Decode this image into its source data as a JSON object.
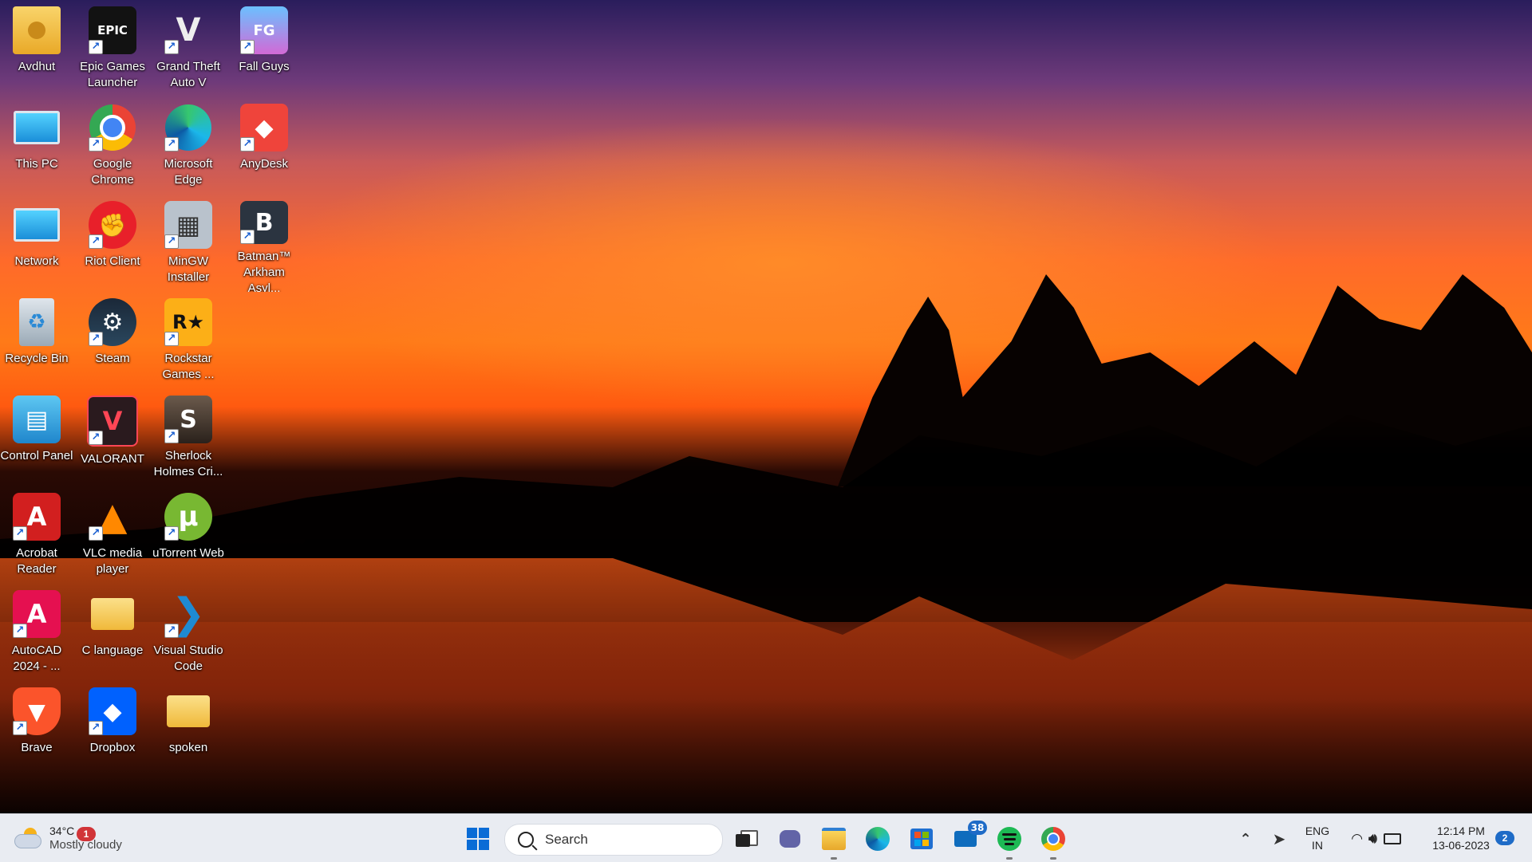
{
  "desktop": {
    "icons": [
      {
        "label": "Avdhut",
        "icon": "folder-user-icon",
        "color": "#f2c14e"
      },
      {
        "label": "Epic Games Launcher",
        "icon": "epic-games-icon",
        "color": "#121212",
        "glyph": "EPIC"
      },
      {
        "label": "Grand Theft Auto V",
        "icon": "gta-v-icon",
        "color": "#1b1b1b",
        "glyph": "V"
      },
      {
        "label": "Fall Guys",
        "icon": "fall-guys-icon",
        "color": "#4aa8ff",
        "glyph": "FG"
      },
      {
        "label": "This PC",
        "icon": "monitor-icon",
        "color": "#3bb3e8"
      },
      {
        "label": "Google Chrome",
        "icon": "chrome-icon",
        "color": "#34a853"
      },
      {
        "label": "Microsoft Edge",
        "icon": "edge-icon",
        "color": "#1f8fd8"
      },
      {
        "label": "AnyDesk",
        "icon": "anydesk-icon",
        "color": "#ef443b",
        "glyph": "◆"
      },
      {
        "label": "Network",
        "icon": "network-globe-icon",
        "color": "#2f8fd6"
      },
      {
        "label": "Riot Client",
        "icon": "riot-fist-icon",
        "color": "#e8202a",
        "glyph": "✊"
      },
      {
        "label": "MinGW Installer",
        "icon": "mingw-installer-icon",
        "color": "#b9c2cc",
        "glyph": "▦"
      },
      {
        "label": "Batman™ Arkham Asyl...",
        "icon": "batman-icon",
        "color": "#2b3440",
        "glyph": "B"
      },
      {
        "label": "Recycle Bin",
        "icon": "recycle-bin-icon",
        "color": "#aab8c4",
        "glyph": "♻"
      },
      {
        "label": "Steam",
        "icon": "steam-icon",
        "color": "#1b2838",
        "glyph": "⚙"
      },
      {
        "label": "Rockstar Games ...",
        "icon": "rockstar-icon",
        "color": "#fcaf17",
        "glyph": "R★"
      },
      {
        "label": "Control Panel",
        "icon": "control-panel-icon",
        "color": "#4ab3e6",
        "glyph": "▤"
      },
      {
        "label": "VALORANT",
        "icon": "valorant-icon",
        "color": "#ff4655",
        "glyph": "V"
      },
      {
        "label": "Sherlock Holmes Cri...",
        "icon": "sherlock-icon",
        "color": "#4a3a30",
        "glyph": "S"
      },
      {
        "label": "Acrobat Reader",
        "icon": "acrobat-icon",
        "color": "#d21f1f",
        "glyph": "A"
      },
      {
        "label": "VLC media player",
        "icon": "vlc-cone-icon",
        "color": "#ff8800",
        "glyph": "▲"
      },
      {
        "label": "uTorrent Web",
        "icon": "utorrent-icon",
        "color": "#78b832",
        "glyph": "µ"
      },
      {
        "label": "AutoCAD 2024 - ...",
        "icon": "autocad-icon",
        "color": "#e51050",
        "glyph": "A"
      },
      {
        "label": "C language",
        "icon": "folder-icon",
        "color": "#f7d26a"
      },
      {
        "label": "Visual Studio Code",
        "icon": "vscode-icon",
        "color": "#1f8ad2",
        "glyph": "❯"
      },
      {
        "label": "Brave",
        "icon": "brave-lion-icon",
        "color": "#fb542b",
        "glyph": "▼"
      },
      {
        "label": "Dropbox",
        "icon": "dropbox-icon",
        "color": "#0061fe",
        "glyph": "◆"
      },
      {
        "label": "spoken",
        "icon": "folder-icon",
        "color": "#f7d26a"
      }
    ]
  },
  "taskbar": {
    "weather": {
      "temp": "34°C",
      "condition": "Mostly cloudy",
      "badge": "1"
    },
    "search": {
      "placeholder": "Search"
    },
    "mail_badge": "38",
    "language": {
      "line1": "ENG",
      "line2": "IN"
    },
    "clock": {
      "time": "12:14 PM",
      "date": "13-06-2023"
    },
    "notification_count": "2",
    "accent": "#0a6cd6"
  }
}
